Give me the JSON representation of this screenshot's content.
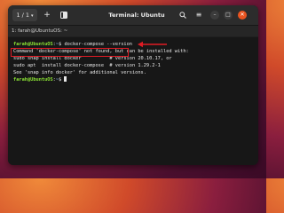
{
  "window": {
    "title": "Terminal: Ubuntu",
    "tab_counter": "1 / 1",
    "tab_label": "1: farah@UbuntuOS: ~"
  },
  "icons": {
    "chevron": "▾",
    "add": "+",
    "split": "split-pane-icon",
    "search": "search-icon",
    "menu": "≡",
    "minimize": "–",
    "maximize": "□",
    "close": "✕"
  },
  "terminal": {
    "prompt_user": "farah@UbuntuOS",
    "prompt_sep": ":",
    "prompt_path": "~",
    "prompt_symbol": "$ ",
    "command": "docker-compose --version",
    "output_lines": [
      "Command 'docker-compose' not found, but can be installed with:",
      "sudo snap install docker          # version 20.10.17, or",
      "sudo apt  install docker-compose  # version 1.29.2-1",
      "See 'snap info docker' for additional versions."
    ],
    "last_prompt_symbol": "$ "
  },
  "colors": {
    "annotation": "#e01b24",
    "close_button": "#e95420",
    "prompt_user": "#8ae234",
    "prompt_path": "#729fcf"
  }
}
